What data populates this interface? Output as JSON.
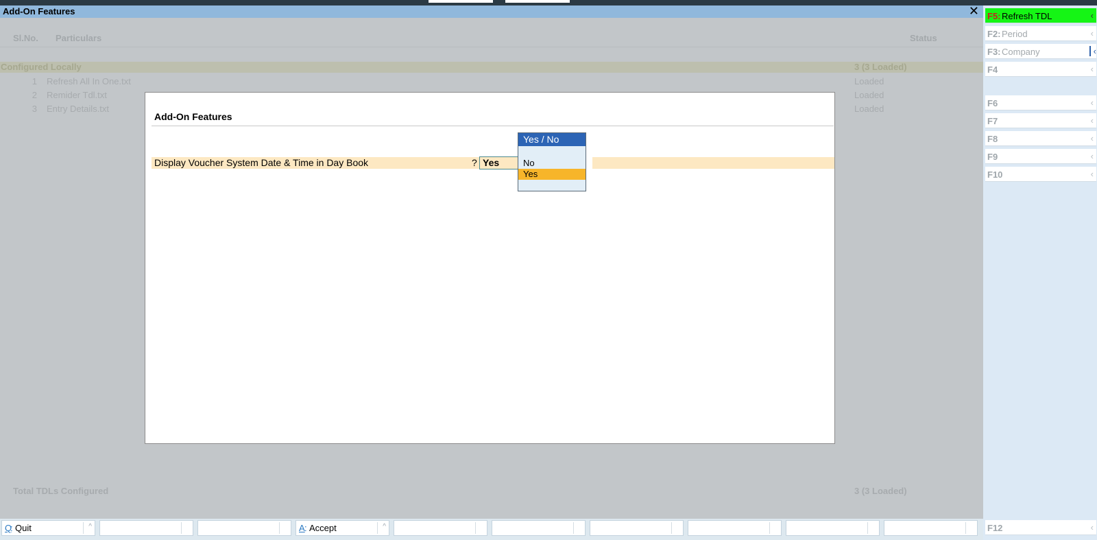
{
  "window": {
    "title": "Add-On Features",
    "close_icon": "✕"
  },
  "columns": {
    "sl_no": "Sl.No.",
    "particulars": "Particulars",
    "status": "Status"
  },
  "section": {
    "label": "Configured Locally",
    "status": "3 (3 Loaded)"
  },
  "items": [
    {
      "no": "1",
      "name": "Refresh All In One.txt",
      "status": "Loaded"
    },
    {
      "no": "2",
      "name": "Remider Tdl.txt",
      "status": "Loaded"
    },
    {
      "no": "3",
      "name": "Entry Details.txt",
      "status": "Loaded"
    }
  ],
  "total": {
    "label": "Total TDLs Configured",
    "status": "3 (3 Loaded)"
  },
  "modal": {
    "title": "Add-On Features",
    "field_label": "Display Voucher System Date & Time in Day Book",
    "field_separator": "?",
    "field_value": "Yes"
  },
  "dropdown": {
    "header": "Yes / No",
    "options": [
      "No",
      "Yes"
    ],
    "selected": "Yes"
  },
  "bottom_buttons": [
    {
      "key": "Q",
      "label": "Quit",
      "caret": "^"
    },
    {
      "key": "A",
      "label": "Accept",
      "caret": "^"
    }
  ],
  "right_buttons": [
    {
      "key": "F5:",
      "label": "Refresh TDL",
      "chevron": "‹"
    },
    {
      "key": "F2:",
      "label": "Period",
      "chevron": "‹"
    },
    {
      "key": "F3:",
      "label": "Company",
      "chevron": "‹"
    },
    {
      "key": "F4",
      "label": "",
      "chevron": "‹"
    },
    {
      "key": "F6",
      "label": "",
      "chevron": "‹"
    },
    {
      "key": "F7",
      "label": "",
      "chevron": "‹"
    },
    {
      "key": "F8",
      "label": "",
      "chevron": "‹"
    },
    {
      "key": "F9",
      "label": "",
      "chevron": "‹"
    },
    {
      "key": "F10",
      "label": "",
      "chevron": "‹"
    },
    {
      "key": "F12",
      "label": "",
      "chevron": "‹"
    }
  ],
  "colors": {
    "active_button": "#15f515",
    "highlight_option": "#f7b52a",
    "dropdown_header": "#2c64b5",
    "title_bar": "#90b8dc"
  }
}
